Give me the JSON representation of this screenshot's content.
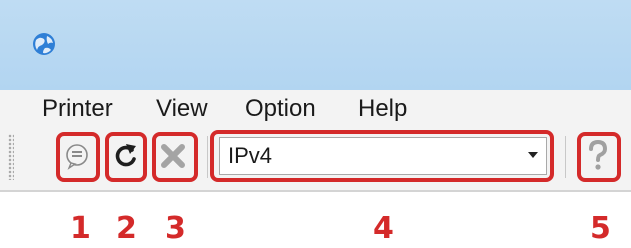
{
  "menu": {
    "items": [
      {
        "label": "Printer"
      },
      {
        "label": "View"
      },
      {
        "label": "Option"
      },
      {
        "label": "Help"
      }
    ]
  },
  "toolbar": {
    "buttons": [
      {
        "icon": "speech-bubble-icon"
      },
      {
        "icon": "refresh-icon"
      },
      {
        "icon": "delete-x-icon"
      },
      {
        "icon": "help-question-icon"
      }
    ],
    "protocol_select": {
      "value": "IPv4"
    }
  },
  "callouts": [
    "1",
    "2",
    "3",
    "4",
    "5"
  ],
  "colors": {
    "callout_red": "#d42a2a",
    "titlebar_blue": "#b2d5f1",
    "menubar_bg": "#f3f3f3"
  }
}
